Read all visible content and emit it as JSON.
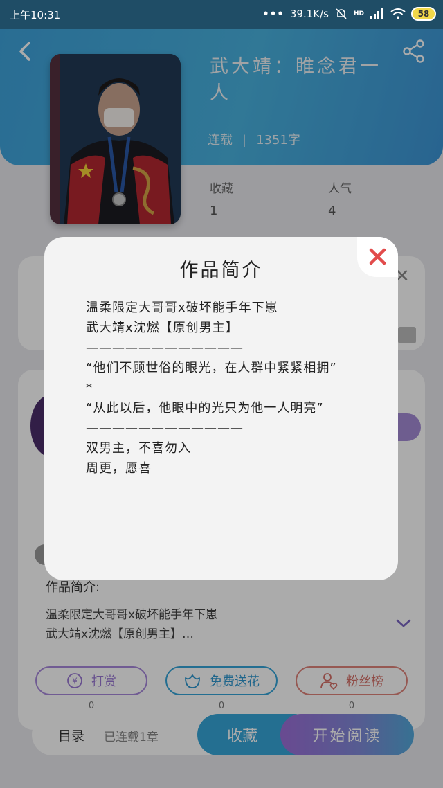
{
  "status_bar": {
    "time": "上午10:31",
    "net_speed": "39.1K/s",
    "signal_label": "HD",
    "battery": "58"
  },
  "book": {
    "title": "武大靖：睢念君一人",
    "status": "连载",
    "word_count": "1351字",
    "stats": [
      {
        "label": "收藏",
        "value": "1"
      },
      {
        "label": "人气",
        "value": "4"
      }
    ]
  },
  "intro_section": {
    "heading": "作品简介:",
    "lines": [
      "温柔限定大哥哥x破坏能手年下崽",
      "武大靖x沈燃【原创男主】…"
    ]
  },
  "actions": [
    {
      "label": "打赏",
      "count": "0",
      "icon": "yen-icon",
      "color": "#9a78d4"
    },
    {
      "label": "免费送花",
      "count": "0",
      "icon": "flower-icon",
      "color": "#2d97d0"
    },
    {
      "label": "粉丝榜",
      "count": "0",
      "icon": "fans-icon",
      "color": "#d66f67"
    }
  ],
  "bottom_bar": {
    "toc_label": "目录",
    "chapters_label": "已连载1章",
    "collect_label": "收藏",
    "read_label": "开始阅读"
  },
  "modal": {
    "title": "作品简介",
    "lines": [
      "温柔限定大哥哥x破坏能手年下崽",
      "武大靖x沈燃【原创男主】",
      "————————————",
      "“他们不顾世俗的眼光，在人群中紧紧相拥”",
      "*",
      "“从此以后，他眼中的光只为他一人明亮”",
      "————————————",
      "双男主，不喜勿入",
      "周更，愿喜"
    ]
  },
  "colors": {
    "header_blue": "#3ea3dc",
    "close_red": "#e24b4b",
    "read_purple": "#9d6fd9"
  }
}
